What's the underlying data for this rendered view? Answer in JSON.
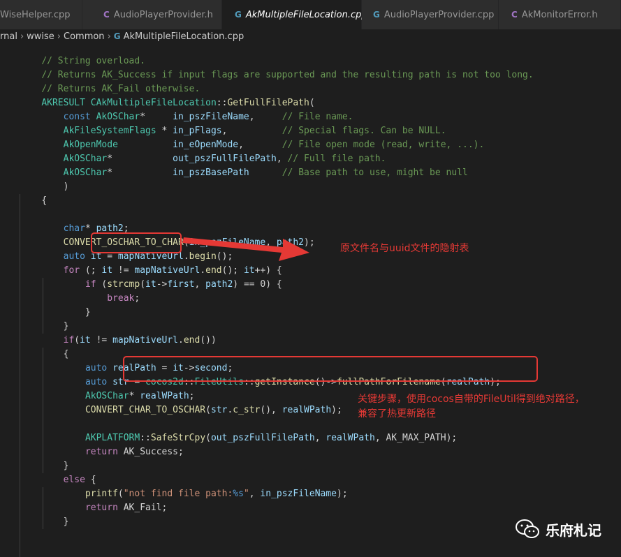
{
  "tabs": [
    {
      "label": "WiseHelper.cpp",
      "icon": "cpp-file-icon",
      "icon_text": "",
      "active": false
    },
    {
      "label": "AudioPlayerProvider.h",
      "icon": "c-header-icon",
      "icon_text": "C",
      "active": false
    },
    {
      "label": "AkMultipleFileLocation.cpp",
      "icon": "cpp-file-icon",
      "icon_text": "G",
      "active": true,
      "close": "✕"
    },
    {
      "label": "AudioPlayerProvider.cpp",
      "icon": "cpp-file-icon",
      "icon_text": "G",
      "active": false
    },
    {
      "label": "AkMonitorError.h",
      "icon": "c-header-icon",
      "icon_text": "C",
      "active": false
    }
  ],
  "breadcrumb": {
    "parts": [
      "rnal",
      "wwise",
      "Common"
    ],
    "file": "AkMultipleFileLocation.cpp",
    "file_icon": "G"
  },
  "code_lines": [
    "// String overload.",
    "// Returns AK_Success if input flags are supported and the resulting path is not too long.",
    "// Returns AK_Fail otherwise.",
    "AKRESULT CAkMultipleFileLocation::GetFullFilePath(",
    "    const AkOSChar*     in_pszFileName,     // File name.",
    "    AkFileSystemFlags * in_pFlags,          // Special flags. Can be NULL.",
    "    AkOpenMode          in_eOpenMode,       // File open mode (read, write, ...).",
    "    AkOSChar*           out_pszFullFilePath, // Full file path.",
    "    AkOSChar*           in_pszBasePath      // Base path to use, might be null",
    "    )",
    "{",
    "",
    "    char* path2;",
    "    CONVERT_OSCHAR_TO_CHAR(in_pszFileName, path2);",
    "    auto it = mapNativeUrl.begin();",
    "    for (; it != mapNativeUrl.end(); it++) {",
    "        if (strcmp(it->first, path2) == 0) {",
    "            break;",
    "        }",
    "    }",
    "    if(it != mapNativeUrl.end())",
    "    {",
    "        auto realPath = it->second;",
    "        auto str = cocos2d::FileUtils::getInstance()->fullPathForFilename(realPath);",
    "        AkOSChar* realWPath;",
    "        CONVERT_CHAR_TO_OSCHAR(str.c_str(), realWPath);",
    "",
    "        AKPLATFORM::SafeStrCpy(out_pszFullFilePath, realWPath, AK_MAX_PATH);",
    "        return AK_Success;",
    "    }",
    "    else {",
    "        printf(\"not find file path:%s\", in_pszFileName);",
    "        return AK_Fail;",
    "    }"
  ],
  "annotations": {
    "mapping_note": "原文件名与uuid文件的隐射表",
    "key_step_note_line1": "关键步骤，使用cocos自带的FileUtil得到绝对路径，",
    "key_step_note_line2": "兼容了热更新路径"
  },
  "watermark": {
    "label": "乐府札记",
    "icon": "wechat-icon"
  },
  "colors": {
    "background": "#1e1e1e",
    "annotation_red": "#e53935",
    "comment": "#6a9955",
    "keyword": "#569cd6",
    "type": "#4ec9b0",
    "function": "#dcdcaa",
    "variable": "#9cdcfe"
  }
}
